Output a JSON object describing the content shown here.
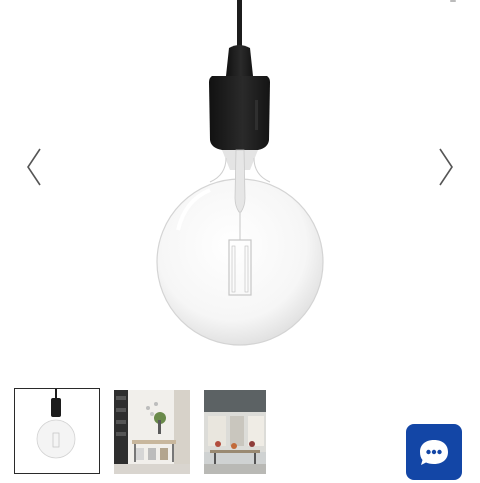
{
  "gallery": {
    "main_image": {
      "icon": "pendant-lamp-bulb-image",
      "cord_color": "#1c1c1c",
      "socket_color": "#1c1c1c"
    },
    "prev_icon": "chevron-left-icon",
    "next_icon": "chevron-right-icon",
    "thumbnails": [
      {
        "icon": "lamp-product-thumbnail",
        "selected": true
      },
      {
        "icon": "dining-room-thumbnail",
        "selected": false
      },
      {
        "icon": "cafe-interior-thumbnail",
        "selected": false
      }
    ]
  },
  "chat": {
    "icon": "chat-bubble-icon",
    "color": "#1346a6"
  }
}
